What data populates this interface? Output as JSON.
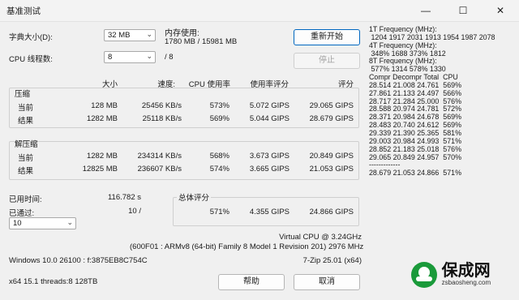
{
  "window": {
    "title": "基准测试",
    "controls": {
      "minimize": "—",
      "maximize": "☐",
      "close": "✕"
    }
  },
  "settings": {
    "dict_label": "字典大小(D):",
    "dict_value": "32 MB",
    "threads_label": "CPU 线程数:",
    "threads_value": "8",
    "threads_total": "/ 8",
    "memory_label": "内存使用:",
    "memory_value": "1780 MB / 15981 MB"
  },
  "buttons": {
    "restart": "重新开始",
    "stop": "停止",
    "help": "帮助",
    "cancel": "取消"
  },
  "headers": {
    "size": "大小",
    "speed": "速度:",
    "cpu_usage": "CPU 使用率",
    "usage_score": "使用率评分",
    "score": "评分"
  },
  "compress": {
    "title": "压缩",
    "current": {
      "label": "当前",
      "size": "128 MB",
      "speed": "25456 KB/s",
      "cpu": "573%",
      "usage": "5.072 GIPS",
      "rating": "29.065 GIPS"
    },
    "result": {
      "label": "结果",
      "size": "1282 MB",
      "speed": "25118 KB/s",
      "cpu": "569%",
      "usage": "5.044 GIPS",
      "rating": "28.679 GIPS"
    }
  },
  "decompress": {
    "title": "解压缩",
    "current": {
      "label": "当前",
      "size": "1282 MB",
      "speed": "234314 KB/s",
      "cpu": "568%",
      "usage": "3.673 GIPS",
      "rating": "20.849 GIPS"
    },
    "result": {
      "label": "结果",
      "size": "12825 MB",
      "speed": "236607 KB/s",
      "cpu": "574%",
      "usage": "3.665 GIPS",
      "rating": "21.053 GIPS"
    }
  },
  "elapsed": {
    "label": "已用时间:",
    "value": "116.782 s"
  },
  "passes": {
    "label": "已通过:",
    "value": "10 /",
    "combo_value": "10"
  },
  "total": {
    "title": "总体评分",
    "cpu": "571%",
    "usage": "4.355 GIPS",
    "rating": "24.866 GIPS"
  },
  "system": {
    "cpu": "Virtual CPU @ 3.24GHz",
    "cpu_detail": "(600F01 : ARMv8 (64-bit) Family 8 Model 1 Revision 201) 2976 MHz",
    "os": "Windows 10.0 26100 : f:3875EB8C754C",
    "version": "7-Zip 25.01 (x64)",
    "arch": "x64 15.1 threads:8 128TB"
  },
  "log_lines": [
    "1T Frequency (MHz):",
    " 1204 1917 2031 1913 1954 1987 2078",
    "4T Frequency (MHz):",
    " 348% 1688 373% 1812",
    "8T Frequency (MHz):",
    " 577% 1314 578% 1330",
    "Compr Decompr Total  CPU",
    "28.514 21.008 24.761  569%",
    "27.861 21.133 24.497  566%",
    "28.717 21.284 25.000  576%",
    "28.588 20.974 24.781  572%",
    "28.371 20.984 24.678  569%",
    "28.483 20.740 24.612  569%",
    "29.339 21.390 25.365  581%",
    "29.003 20.984 24.993  571%",
    "28.852 21.183 25.018  576%",
    "29.065 20.849 24.957  570%",
    "-------------",
    "28.679 21.053 24.866  571%"
  ],
  "watermark": {
    "brand": "保成网",
    "url": "zsbaosheng.com"
  },
  "colors": {
    "accent": "#0067c0",
    "watermark_green": "#1a9a3a"
  }
}
